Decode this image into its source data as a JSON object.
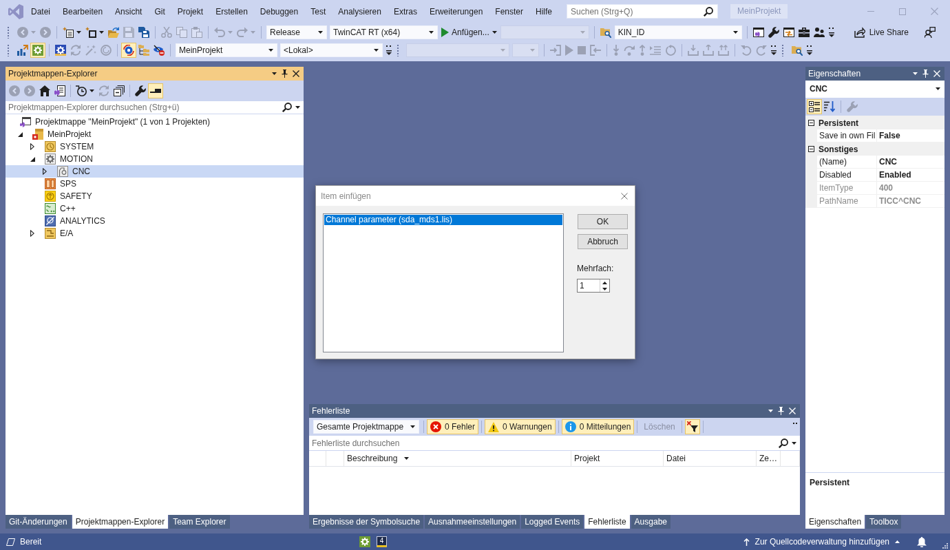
{
  "menu_bar": {
    "items": [
      "Datei",
      "Bearbeiten",
      "Ansicht",
      "Git",
      "Projekt",
      "Erstellen",
      "Debuggen",
      "Test",
      "Analysieren",
      "Extras",
      "Erweiterungen",
      "Fenster",
      "Hilfe"
    ],
    "search": {
      "placeholder": "Suchen (Strg+Q)"
    },
    "solution_name": "MeinProjekt"
  },
  "toolbar_rows": [
    {
      "toolbars": [
        {
          "groups": [
            [
              {
                "kind": "back",
                "disabled": true,
                "menu": true
              },
              {
                "kind": "forward",
                "disabled": true
              }
            ],
            [
              {
                "kind": "newproject",
                "disabled": false,
                "menu": true
              },
              {
                "kind": "additem",
                "disabled": false,
                "menu": true
              },
              {
                "kind": "open",
                "disabled": false
              },
              {
                "kind": "save",
                "disabled": true
              },
              {
                "kind": "saveall",
                "disabled": false
              }
            ],
            [
              {
                "kind": "cut",
                "disabled": true
              },
              {
                "kind": "copy",
                "disabled": true
              },
              {
                "kind": "paste",
                "disabled": true
              }
            ],
            [
              {
                "kind": "undo",
                "disabled": true,
                "menu": true
              },
              {
                "kind": "redo",
                "disabled": true,
                "menu": true
              }
            ],
            [
              {
                "kind": "combo",
                "value": "Release",
                "disabled": false
              },
              {
                "kind": "combo",
                "value": "TwinCAT RT (x64)",
                "disabled": false
              },
              {
                "kind": "start",
                "label": "Anfügen...",
                "disabled": false,
                "menu": true
              },
              {
                "kind": "combo",
                "disabled": true
              }
            ],
            [
              {
                "kind": "findfolder",
                "disabled": false
              },
              {
                "kind": "combo",
                "value": "KIN_ID",
                "disabled": false
              }
            ],
            [
              {
                "kind": "window",
                "disabled": false
              },
              {
                "kind": "wrench",
                "disabled": false
              },
              {
                "kind": "windowarrows",
                "disabled": false
              },
              {
                "kind": "toolbox",
                "disabled": false
              },
              {
                "kind": "people",
                "disabled": false
              },
              {
                "kind": "overflow",
                "disabled": false
              }
            ]
          ]
        }
      ],
      "live_share": "Live Share"
    },
    {
      "toolbars": [
        {
          "groups": [
            [
              {
                "kind": "bars",
                "disabled": false,
                "checked": false
              },
              {
                "kind": "gearbox",
                "disabled": false,
                "checked": true
              }
            ],
            [
              {
                "kind": "gear",
                "disabled": false,
                "checked": false
              },
              {
                "kind": "sync",
                "disabled": true,
                "checked": false
              },
              {
                "kind": "wand",
                "disabled": true,
                "checked": false
              },
              {
                "kind": "circlearrow",
                "disabled": true,
                "checked": false
              }
            ],
            [
              {
                "kind": "target",
                "disabled": false,
                "checked": true
              },
              {
                "kind": "foldertree",
                "disabled": false,
                "checked": false
              },
              {
                "kind": "eyeoff",
                "disabled": false,
                "checked": false
              }
            ],
            [
              {
                "kind": "combo",
                "value": "MeinProjekt",
                "disabled": false
              },
              {
                "kind": "combo",
                "value": "<Lokal>",
                "disabled": false
              },
              {
                "kind": "overflow",
                "disabled": false,
                "checked": false
              }
            ]
          ]
        },
        {
          "groups": [
            [
              {
                "kind": "combo",
                "disabled": true
              },
              {
                "kind": "combo",
                "disabled": true
              }
            ],
            [
              {
                "kind": "enter",
                "disabled": true
              },
              {
                "kind": "play",
                "disabled": true
              },
              {
                "kind": "stop",
                "disabled": true
              },
              {
                "kind": "exit",
                "disabled": true
              }
            ],
            [
              {
                "kind": "stepin",
                "disabled": true
              },
              {
                "kind": "stepover",
                "disabled": true
              },
              {
                "kind": "stepout",
                "disabled": true
              },
              {
                "kind": "list",
                "disabled": true
              },
              {
                "kind": "restart",
                "disabled": true
              }
            ],
            [
              {
                "kind": "trayin",
                "disabled": true
              },
              {
                "kind": "trayout",
                "disabled": true
              },
              {
                "kind": "trayall",
                "disabled": true
              }
            ],
            [
              {
                "kind": "rotateleft",
                "disabled": true
              },
              {
                "kind": "rotateright",
                "disabled": true
              },
              {
                "kind": "overflow",
                "disabled": false
              }
            ]
          ]
        },
        {
          "groups": [
            [
              {
                "kind": "findfolder",
                "disabled": false
              },
              {
                "kind": "overflow",
                "disabled": false
              }
            ]
          ]
        }
      ]
    }
  ],
  "solution_explorer": {
    "title": "Projektmappen-Explorer",
    "active": true,
    "toolbar": [
      [
        {
          "kind": "back",
          "disabled": true,
          "checked": false
        },
        {
          "kind": "forward",
          "disabled": true,
          "checked": false
        },
        {
          "kind": "home",
          "disabled": false,
          "checked": false
        },
        {
          "kind": "switchview",
          "disabled": false,
          "checked": false
        }
      ],
      [
        {
          "kind": "history",
          "disabled": false,
          "checked": false,
          "menu": true
        },
        {
          "kind": "sync",
          "disabled": true,
          "checked": false
        },
        {
          "kind": "collapse",
          "disabled": false,
          "checked": false
        }
      ],
      [
        {
          "kind": "wrench",
          "disabled": false,
          "checked": false
        },
        {
          "kind": "preview",
          "disabled": false,
          "checked": true
        }
      ]
    ],
    "search": {
      "placeholder": "Projektmappen-Explorer durchsuchen (Strg+ü)"
    },
    "tree": [
      {
        "label": "Projektmappe \"MeinProjekt\" (1 von 1 Projekten)",
        "kind": "solution",
        "selected": false,
        "children": [
          {
            "label": "MeinProjekt",
            "kind": "project",
            "expanded": true,
            "selected": false,
            "children": [
              {
                "label": "SYSTEM",
                "kind": "system",
                "expanded": false,
                "selected": false
              },
              {
                "label": "MOTION",
                "kind": "motion",
                "expanded": true,
                "selected": false,
                "children": [
                  {
                    "label": "CNC",
                    "kind": "cnc",
                    "expanded": false,
                    "selected": true
                  }
                ]
              },
              {
                "label": "SPS",
                "kind": "plc",
                "selected": false
              },
              {
                "label": "SAFETY",
                "kind": "safety",
                "selected": false
              },
              {
                "label": "C++",
                "kind": "cpp",
                "selected": false
              },
              {
                "label": "ANALYTICS",
                "kind": "analytics",
                "selected": false
              },
              {
                "label": "E/A",
                "kind": "io",
                "expanded": false,
                "selected": false
              }
            ]
          }
        ]
      }
    ],
    "tabs": [
      {
        "label": "Git-Änderungen",
        "selected": false
      },
      {
        "label": "Projektmappen-Explorer",
        "selected": true
      },
      {
        "label": "Team Explorer",
        "selected": false
      }
    ]
  },
  "dialog": {
    "title": "Item einfügen",
    "items": [
      {
        "label": "Channel parameter (sda_mds1.lis)",
        "selected": true
      }
    ],
    "buttons": [
      "OK",
      "Abbruch"
    ],
    "count_label": "Mehrfach:",
    "count": "1"
  },
  "error_list": {
    "title": "Fehlerliste",
    "active": false,
    "scope": "Gesamte Projektmappe",
    "filters": [
      {
        "kind": "error",
        "label": "0 Fehler",
        "checked": true
      },
      {
        "kind": "warning",
        "label": "0 Warnungen",
        "checked": true
      },
      {
        "kind": "info",
        "label": "0 Mitteilungen",
        "checked": true
      }
    ],
    "clear_button": {
      "label": "Löschen",
      "disabled": true
    },
    "filter_toggle": {
      "kind": "filterx",
      "disabled": false,
      "checked": true
    },
    "search": {
      "placeholder": "Fehlerliste durchsuchen"
    },
    "columns": [
      {
        "label": "Beschreibung",
        "sorted": true
      },
      {
        "label": "Projekt",
        "sorted": false
      },
      {
        "label": "Datei",
        "sorted": false
      },
      {
        "label": "Ze…",
        "sorted": false
      }
    ],
    "tabs": [
      {
        "label": "Ergebnisse der Symbolsuche",
        "selected": false
      },
      {
        "label": "Ausnahmeeinstellungen",
        "selected": false
      },
      {
        "label": "Logged Events",
        "selected": false
      },
      {
        "label": "Fehlerliste",
        "selected": true
      },
      {
        "label": "Ausgabe",
        "selected": false
      }
    ]
  },
  "properties": {
    "title": "Eigenschaften",
    "active": false,
    "object": "CNC",
    "toolbar": [
      [
        {
          "kind": "categorized",
          "disabled": false,
          "checked": true
        },
        {
          "kind": "alphabetical",
          "disabled": false,
          "checked": false
        }
      ],
      [
        {
          "kind": "wrench",
          "disabled": true,
          "checked": false
        }
      ]
    ],
    "categories": [
      {
        "name": "Persistent",
        "expanded": true,
        "rows": [
          {
            "name": "Save in own Fil",
            "value": "False",
            "readonly": false
          }
        ]
      },
      {
        "name": "Sonstiges",
        "expanded": true,
        "rows": [
          {
            "name": "(Name)",
            "value": "CNC",
            "readonly": false
          },
          {
            "name": "Disabled",
            "value": "Enabled",
            "readonly": false
          },
          {
            "name": "ItemType",
            "value": "400",
            "readonly": true
          },
          {
            "name": "PathName",
            "value": "TICC^CNC",
            "readonly": true
          }
        ]
      }
    ],
    "description": "Persistent",
    "tabs": [
      {
        "label": "Eigenschaften",
        "selected": true
      },
      {
        "label": "Toolbox",
        "selected": false
      }
    ]
  },
  "status_bar": {
    "text": "Bereit",
    "badge": "4",
    "source_control": "Zur Quellcodeverwaltung hinzufügen"
  }
}
